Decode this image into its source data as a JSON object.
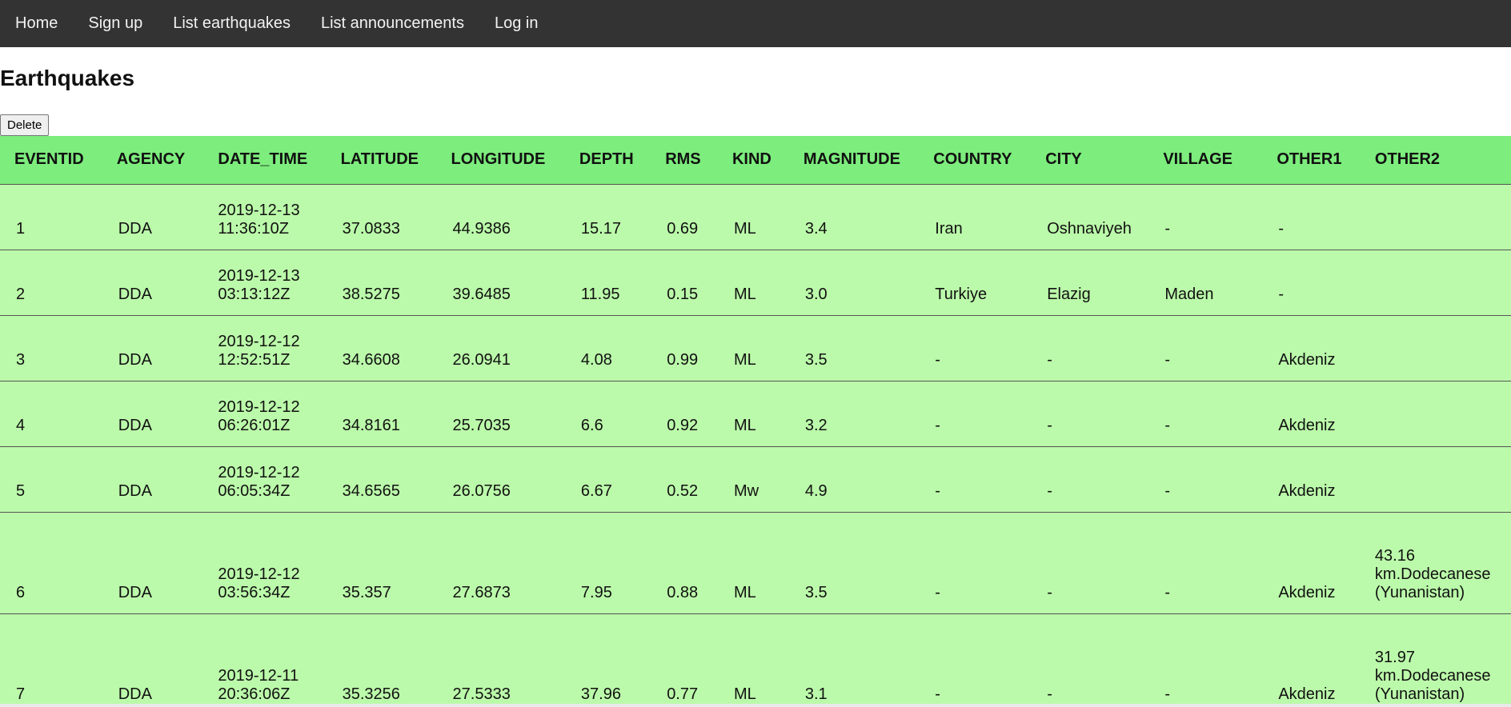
{
  "nav": {
    "items": [
      "Home",
      "Sign up",
      "List earthquakes",
      "List announcements",
      "Log in"
    ]
  },
  "page": {
    "title": "Earthquakes",
    "delete_label": "Delete"
  },
  "table": {
    "headers": [
      "EVENTID",
      "AGENCY",
      "DATE_TIME",
      "LATITUDE",
      "LONGITUDE",
      "DEPTH",
      "RMS",
      "KIND",
      "MAGNITUDE",
      "COUNTRY",
      "CITY",
      "VILLAGE",
      "OTHER1",
      "OTHER2"
    ],
    "rows": [
      [
        "1",
        "DDA",
        "2019-12-13 11:36:10Z",
        "37.0833",
        "44.9386",
        "15.17",
        "0.69",
        "ML",
        "3.4",
        "Iran",
        "Oshnaviyeh",
        "-",
        "-",
        ""
      ],
      [
        "2",
        "DDA",
        "2019-12-13 03:13:12Z",
        "38.5275",
        "39.6485",
        "11.95",
        "0.15",
        "ML",
        "3.0",
        "Turkiye",
        "Elazig",
        "Maden",
        "-",
        ""
      ],
      [
        "3",
        "DDA",
        "2019-12-12 12:52:51Z",
        "34.6608",
        "26.0941",
        "4.08",
        "0.99",
        "ML",
        "3.5",
        "-",
        "-",
        "-",
        "Akdeniz",
        ""
      ],
      [
        "4",
        "DDA",
        "2019-12-12 06:26:01Z",
        "34.8161",
        "25.7035",
        "6.6",
        "0.92",
        "ML",
        "3.2",
        "-",
        "-",
        "-",
        "Akdeniz",
        ""
      ],
      [
        "5",
        "DDA",
        "2019-12-12 06:05:34Z",
        "34.6565",
        "26.0756",
        "6.67",
        "0.52",
        "Mw",
        "4.9",
        "-",
        "-",
        "-",
        "Akdeniz",
        ""
      ],
      [
        "6",
        "DDA",
        "2019-12-12 03:56:34Z",
        "35.357",
        "27.6873",
        "7.95",
        "0.88",
        "ML",
        "3.5",
        "-",
        "-",
        "-",
        "Akdeniz",
        "43.16 km.Dodecanese (Yunanistan)"
      ],
      [
        "7",
        "DDA",
        "2019-12-11 20:36:06Z",
        "35.3256",
        "27.5333",
        "37.96",
        "0.77",
        "ML",
        "3.1",
        "-",
        "-",
        "-",
        "Akdeniz",
        "31.97 km.Dodecanese (Yunanistan)"
      ]
    ]
  }
}
